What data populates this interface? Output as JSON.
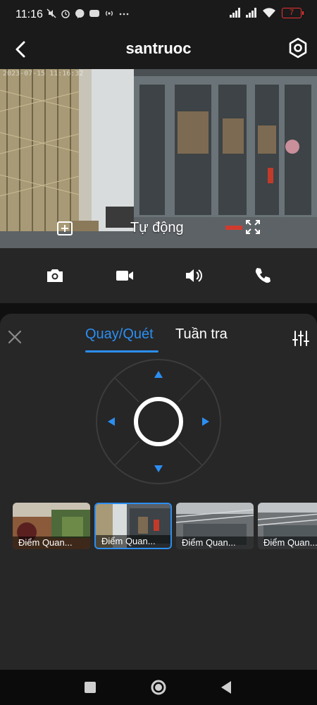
{
  "status_bar": {
    "time": "11:16",
    "battery_level": "7",
    "left_icons": [
      "mute-icon",
      "alarm-icon",
      "messenger-icon",
      "zalo-icon",
      "hotspot-icon",
      "more-icon"
    ],
    "right_icons": [
      "signal-icon",
      "signal-icon",
      "wifi-icon",
      "battery-icon"
    ]
  },
  "header": {
    "title": "santruoc",
    "back_icon": "back-arrow-icon",
    "settings_icon": "hex-settings-icon"
  },
  "video": {
    "timestamp": "2023-07-15 11:16:32",
    "mode_label": "Tự động",
    "split_icon": "split-screen-icon",
    "fullscreen_icon": "fullscreen-icon"
  },
  "controls": {
    "items": [
      "camera-icon",
      "video-record-icon",
      "speaker-icon",
      "phone-icon"
    ]
  },
  "ptz_panel": {
    "tabs": [
      {
        "label": "Quay/Quét",
        "active": true
      },
      {
        "label": "Tuần tra",
        "active": false
      }
    ],
    "close_icon": "close-icon",
    "adjust_icon": "sliders-icon",
    "joystick_directions": [
      "up",
      "right",
      "down",
      "left"
    ]
  },
  "presets": [
    {
      "label": "Điểm Quan...",
      "selected": false
    },
    {
      "label": "Điểm Quan...",
      "selected": true
    },
    {
      "label": "Điểm Quan...",
      "selected": false
    },
    {
      "label": "Điểm Quan...",
      "selected": false
    }
  ],
  "nav_bar": {
    "items": [
      "recent-apps-icon",
      "home-icon",
      "back-icon"
    ]
  },
  "colors": {
    "accent": "#2c8ef2",
    "panel": "#272727",
    "battery_low": "#e33333"
  }
}
